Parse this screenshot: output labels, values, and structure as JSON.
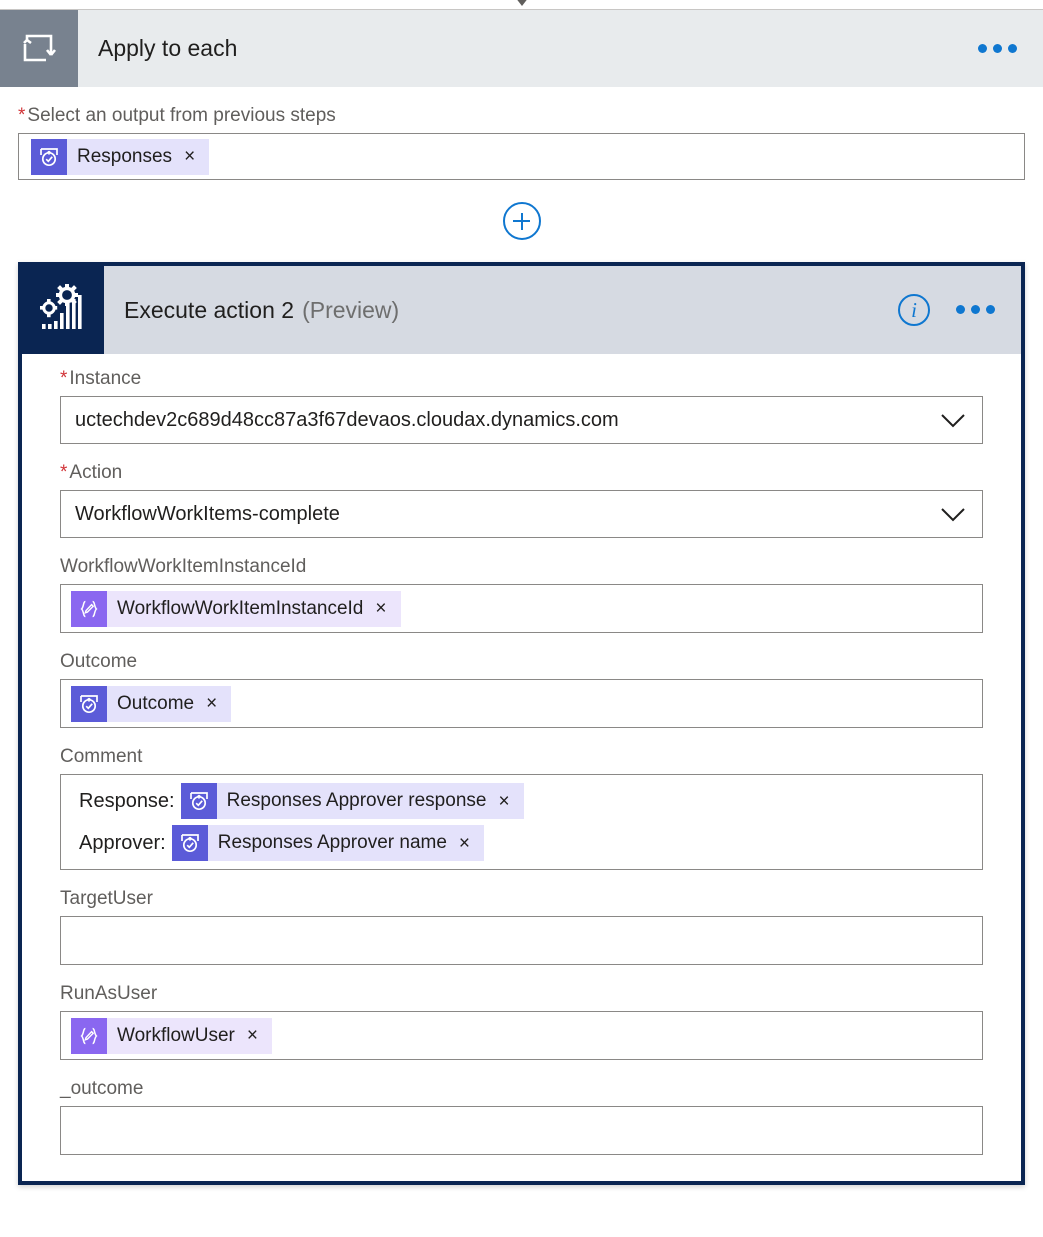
{
  "apply_to_each": {
    "title": "Apply to each",
    "icon": "loop-icon",
    "more_label": "...",
    "field": {
      "label": "Select an output from previous steps",
      "required": true,
      "token": {
        "label": "Responses",
        "icon": "approval-token-icon",
        "remove_label": "×"
      }
    }
  },
  "add_step_button": {
    "label": "+",
    "name": "add-action-button"
  },
  "execute_action": {
    "title": "Execute action 2",
    "preview_label": "(Preview)",
    "icon": "dynamics-finance-operations-icon",
    "info_label": "i",
    "more_label": "...",
    "selected": true,
    "fields": [
      {
        "key": "instance",
        "label": "Instance",
        "required": true,
        "type": "select",
        "value": "uctechdev2c689d48cc87a3f67devaos.cloudax.dynamics.com"
      },
      {
        "key": "action",
        "label": "Action",
        "required": true,
        "type": "select",
        "value": "WorkflowWorkItems-complete"
      },
      {
        "key": "workflow_work_item_instance_id",
        "label": "WorkflowWorkItemInstanceId",
        "required": false,
        "type": "tokens",
        "tokens": [
          {
            "label": "WorkflowWorkItemInstanceId",
            "icon": "expression-token-icon",
            "kind": "expression",
            "remove_label": "×"
          }
        ]
      },
      {
        "key": "outcome",
        "label": "Outcome",
        "required": false,
        "type": "tokens",
        "tokens": [
          {
            "label": "Outcome",
            "icon": "approval-token-icon",
            "kind": "approval",
            "remove_label": "×"
          }
        ]
      },
      {
        "key": "comment",
        "label": "Comment",
        "required": false,
        "type": "token-lines",
        "lines": [
          {
            "prefix": "Response:",
            "token": {
              "label": "Responses Approver response",
              "icon": "approval-token-icon",
              "kind": "approval",
              "remove_label": "×"
            }
          },
          {
            "prefix": "Approver:",
            "token": {
              "label": "Responses Approver name",
              "icon": "approval-token-icon",
              "kind": "approval",
              "remove_label": "×"
            }
          }
        ]
      },
      {
        "key": "target_user",
        "label": "TargetUser",
        "required": false,
        "type": "empty",
        "value": "",
        "placeholder": ""
      },
      {
        "key": "run_as_user",
        "label": "RunAsUser",
        "required": false,
        "type": "tokens",
        "tokens": [
          {
            "label": "WorkflowUser",
            "icon": "expression-token-icon",
            "kind": "expression",
            "remove_label": "×"
          }
        ]
      },
      {
        "key": "_outcome",
        "label": "_outcome",
        "required": false,
        "type": "empty",
        "value": "",
        "placeholder": ""
      }
    ]
  },
  "colors": {
    "apply_to_each_header": "#e8ebed",
    "apply_to_each_icon_tile": "#78828f",
    "execute_action_header": "#d6dae2",
    "execute_action_icon_tile": "#0a2552",
    "selection_border": "#0a2552",
    "accent_blue": "#0f77d0",
    "required_star": "#d13438",
    "approval_token": "#5b5bd8",
    "expression_token": "#8a67f0",
    "token_background": "#e4e2fb"
  }
}
